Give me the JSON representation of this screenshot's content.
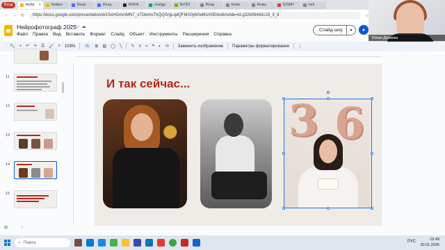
{
  "browser": {
    "profile_label": "Вход",
    "tabs": [
      {
        "label": "Нейр",
        "active": true
      },
      {
        "label": "Нейро",
        "active": false
      },
      {
        "label": "Deep",
        "active": false
      },
      {
        "label": "Deep",
        "active": false
      },
      {
        "label": "KREA",
        "active": false
      },
      {
        "label": "chatgp",
        "active": false
      },
      {
        "label": "NVIDI",
        "active": false
      },
      {
        "label": "Вход",
        "active": false
      },
      {
        "label": "Ново",
        "active": false
      },
      {
        "label": "Новы",
        "active": false
      },
      {
        "label": "GISMI",
        "active": false
      },
      {
        "label": "neir",
        "active": false
      }
    ],
    "url": "https://docs.google.com/presentation/d/1SxHGmmMN7_v7OwmvThQQSrgLqdQFMX0yb0wbhzH30/edit#slide=id.g32b094b5c18_3_9"
  },
  "header": {
    "title": "Нейрофотограф 2025",
    "menu": [
      "Файл",
      "Правка",
      "Вид",
      "Вставить",
      "Формат",
      "Слайд",
      "Объект",
      "Инструменты",
      "Расширения",
      "Справка"
    ],
    "slideshow_label": "Слайд-шоу"
  },
  "webcam": {
    "name": "Юлия Датиева"
  },
  "toolbar": {
    "zoom": "103%",
    "replace_image": "Заменить изображение",
    "format_options": "Параметры форматирования"
  },
  "filmstrip": {
    "slides": [
      {
        "number": "11"
      },
      {
        "number": "12"
      },
      {
        "number": "13"
      },
      {
        "number": "14",
        "selected": true
      },
      {
        "number": "15"
      }
    ]
  },
  "slide": {
    "title": "И так сейчас...",
    "balloon_left": "3",
    "balloon_right": "6"
  },
  "taskbar": {
    "search_placeholder": "Поиск",
    "lang": "РУС",
    "time": "19:49",
    "date": "30.01.2025"
  },
  "colors": {
    "title_red": "#b3261e",
    "selection_blue": "#1a73e8",
    "slides_yellow": "#f4b400"
  }
}
